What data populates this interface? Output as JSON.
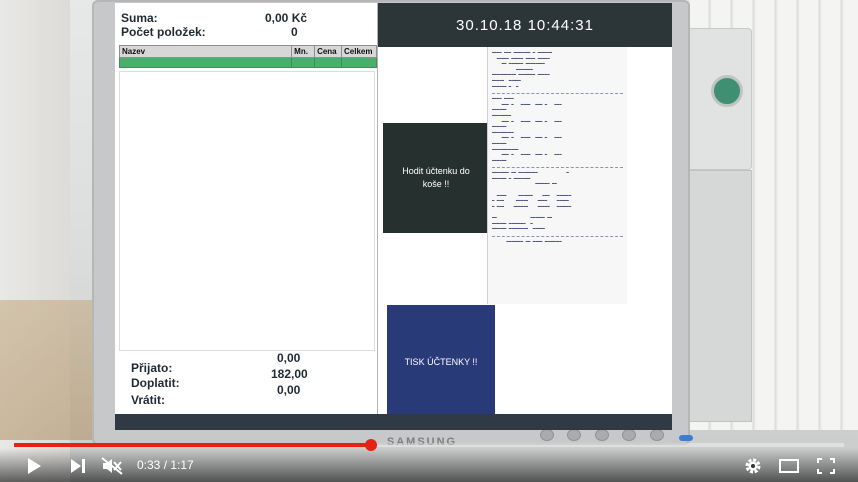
{
  "pos": {
    "sum_label": "Suma:",
    "sum_value": "0,00 Kč",
    "count_label": "Počet položek:",
    "count_value": "0",
    "table_headers": [
      "Nazev",
      "Mn.",
      "Cena",
      "Celkem"
    ],
    "received_label": "Přijato:",
    "received_value": "0,00",
    "topay_label": "Doplatit:",
    "topay_value": "182,00",
    "change_label": "Vrátit:",
    "change_value": "0,00",
    "datetime": "30.10.18  10:44:31",
    "discard_button_label": "Hodit účtenku do\nkoše !!",
    "print_button_label": "TISK ÚČTENKY !!",
    "accent_green": "#4cae6b",
    "print_button_color": "#283a78"
  },
  "monitor": {
    "brand": "SAMSUNG"
  },
  "player": {
    "time": "0:33 / 1:17",
    "progress": 0.43,
    "progress_color": "#e62117"
  }
}
